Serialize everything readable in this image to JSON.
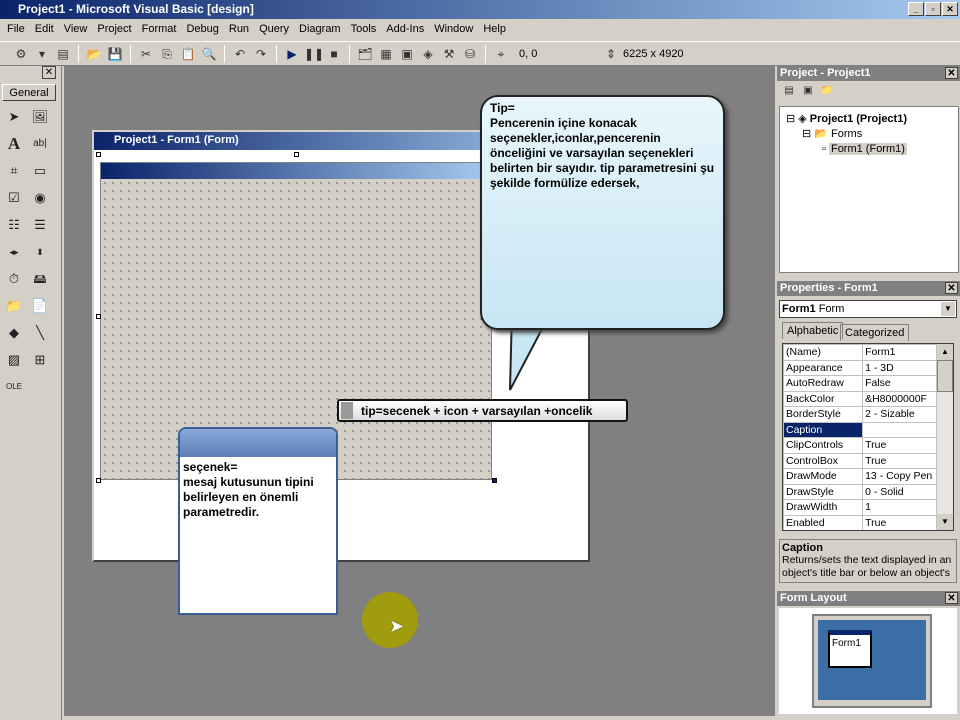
{
  "window": {
    "title": "Project1 - Microsoft Visual Basic [design]"
  },
  "menu": [
    "File",
    "Edit",
    "View",
    "Project",
    "Format",
    "Debug",
    "Run",
    "Query",
    "Diagram",
    "Tools",
    "Add-Ins",
    "Window",
    "Help"
  ],
  "toolbar": {
    "position": "0, 0",
    "size": "6225 x 4920"
  },
  "toolbox": {
    "tab": "General"
  },
  "form_window": {
    "title": "Project1 - Form1 (Form)"
  },
  "callouts": {
    "tip": [
      "Tip=",
      "Pencerenin içine konacak seçenekler,iconlar,pencerenin önceliğini ve varsayılan seçenekleri belirten bir sayıdır. tip parametresini şu şekilde formülize edersek,"
    ],
    "formula": "tip=secenek + icon + varsayılan +oncelik",
    "secenek": [
      "seçenek=",
      "mesaj kutusunun tipini belirleyen en önemli parametredir."
    ]
  },
  "project_panel": {
    "title": "Project - Project1",
    "tree": [
      "Project1 (Project1)",
      "Forms",
      "Form1 (Form1)"
    ]
  },
  "properties_panel": {
    "title": "Properties - Form1",
    "object": "Form1",
    "object_type": "Form",
    "tabs": [
      "Alphabetic",
      "Categorized"
    ],
    "rows": [
      [
        "(Name)",
        "Form1"
      ],
      [
        "Appearance",
        "1 - 3D"
      ],
      [
        "AutoRedraw",
        "False"
      ],
      [
        "BackColor",
        "&H8000000F"
      ],
      [
        "BorderStyle",
        "2 - Sizable"
      ],
      [
        "Caption",
        ""
      ],
      [
        "ClipControls",
        "True"
      ],
      [
        "ControlBox",
        "True"
      ],
      [
        "DrawMode",
        "13 - Copy Pen"
      ],
      [
        "DrawStyle",
        "0 - Solid"
      ],
      [
        "DrawWidth",
        "1"
      ],
      [
        "Enabled",
        "True"
      ]
    ],
    "desc_title": "Caption",
    "desc_text": "Returns/sets the text displayed in an object's title bar or below an object's"
  },
  "form_layout": {
    "title": "Form Layout",
    "form_label": "Form1"
  }
}
